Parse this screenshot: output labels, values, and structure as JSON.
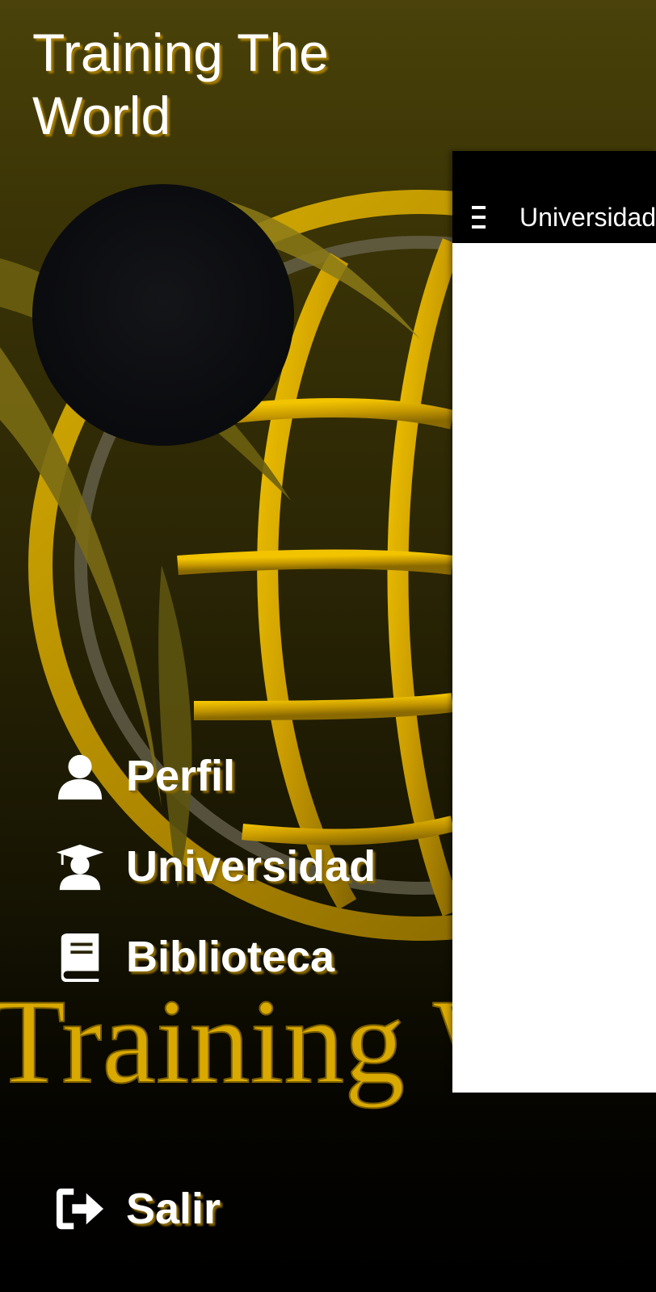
{
  "drawer": {
    "app_title": "Training The World",
    "background_watermark": "Training World",
    "menu": {
      "profile": {
        "label": "Perfil",
        "icon": "user-icon"
      },
      "university": {
        "label": "Universidad",
        "icon": "graduate-icon"
      },
      "library": {
        "label": "Biblioteca",
        "icon": "book-icon"
      },
      "logout": {
        "label": "Salir",
        "icon": "sign-out-icon"
      }
    }
  },
  "content": {
    "app_bar": {
      "title": "Universidad",
      "menu_icon": "hamburger-menu-icon"
    }
  },
  "colors": {
    "accent_gold": "#e6b800",
    "drawer_dark": "#2a2505",
    "content_background": "#ffffff",
    "app_bar": "#000000"
  }
}
